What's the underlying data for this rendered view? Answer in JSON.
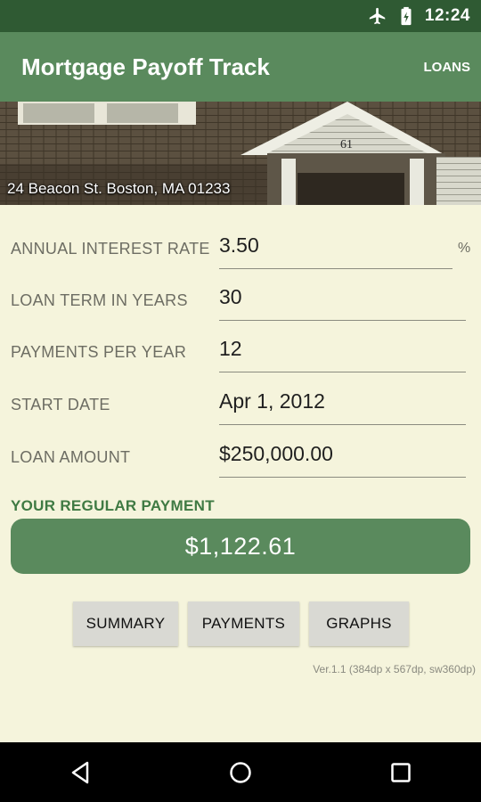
{
  "status_bar": {
    "time": "12:24",
    "icons": [
      "airplane-icon",
      "battery-icon"
    ]
  },
  "app_bar": {
    "title": "Mortgage Payoff Track",
    "action_label": "LOANS"
  },
  "banner": {
    "address": "24 Beacon St. Boston, MA 01233",
    "house_number": "61"
  },
  "form": {
    "interest": {
      "label": "ANNUAL INTEREST RATE",
      "value": "3.50",
      "unit": "%"
    },
    "term": {
      "label": "LOAN TERM IN YEARS",
      "value": "30"
    },
    "payments_per_year": {
      "label": "PAYMENTS PER YEAR",
      "value": "12"
    },
    "start_date": {
      "label": "START DATE",
      "value": "Apr 1, 2012"
    },
    "loan_amount": {
      "label": "LOAN AMOUNT",
      "value": "$250,000.00"
    }
  },
  "payment": {
    "label": "YOUR REGULAR PAYMENT",
    "value": "$1,122.61"
  },
  "buttons": {
    "summary": "SUMMARY",
    "payments": "PAYMENTS",
    "graphs": "GRAPHS"
  },
  "version": "Ver.1.1 (384dp x 567dp, sw360dp)",
  "nav": {
    "icons": [
      "back-icon",
      "home-icon",
      "recents-icon"
    ]
  },
  "colors": {
    "status_bar": "#2f5a33",
    "app_bar": "#5a8a5d",
    "background": "#f5f4dc",
    "accent_text": "#3f7a43"
  }
}
